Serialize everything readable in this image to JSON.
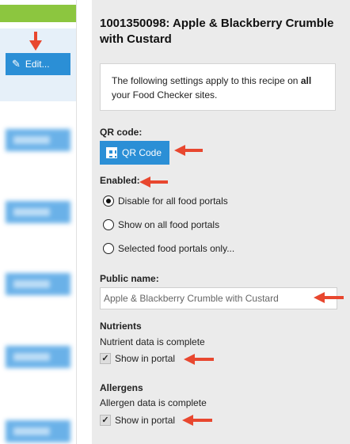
{
  "left_panel": {
    "edit_label": "Edit..."
  },
  "recipe": {
    "title": "1001350098: Apple & Blackberry Crumble with Custard"
  },
  "note": {
    "pre": "The following settings apply to this recipe on ",
    "bold": "all",
    "post": " your Food Checker sites."
  },
  "qr": {
    "label": "QR code:",
    "button_label": "QR Code"
  },
  "enabled": {
    "label": "Enabled:",
    "options": [
      {
        "label": "Disable for all food portals",
        "checked": true
      },
      {
        "label": "Show on all food portals",
        "checked": false
      },
      {
        "label": "Selected food portals only...",
        "checked": false
      }
    ]
  },
  "public_name": {
    "label": "Public name:",
    "value": "Apple & Blackberry Crumble with Custard"
  },
  "nutrients": {
    "label": "Nutrients",
    "status": "Nutrient data is complete",
    "checkbox_label": "Show in portal",
    "checked": true
  },
  "allergens": {
    "label": "Allergens",
    "status": "Allergen data is complete",
    "checkbox_label": "Show in portal",
    "checked": true
  },
  "colors": {
    "accent_blue": "#2b8fd6",
    "arrow_red": "#e8472f",
    "green_bar": "#8cc63f"
  }
}
